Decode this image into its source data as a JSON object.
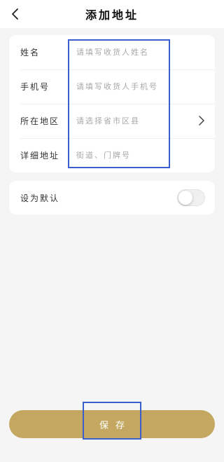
{
  "header": {
    "back_icon": "chevron-left-icon",
    "title": "添加地址"
  },
  "form": {
    "name": {
      "label": "姓名",
      "placeholder": "请填写收货人姓名",
      "value": ""
    },
    "phone": {
      "label": "手机号",
      "placeholder": "请填写收货人手机号",
      "value": ""
    },
    "region": {
      "label": "所在地区",
      "placeholder": "请选择省市区县",
      "value": "",
      "chevron_icon": "chevron-right-icon"
    },
    "detail": {
      "label": "详细地址",
      "placeholder": "街道、门牌号",
      "value": ""
    }
  },
  "default_setting": {
    "label": "设为默认",
    "enabled": false
  },
  "footer": {
    "save_label": "保存"
  },
  "colors": {
    "accent": "#c4a862",
    "highlight": "#3a5fcd",
    "background": "#f5f5f5"
  }
}
